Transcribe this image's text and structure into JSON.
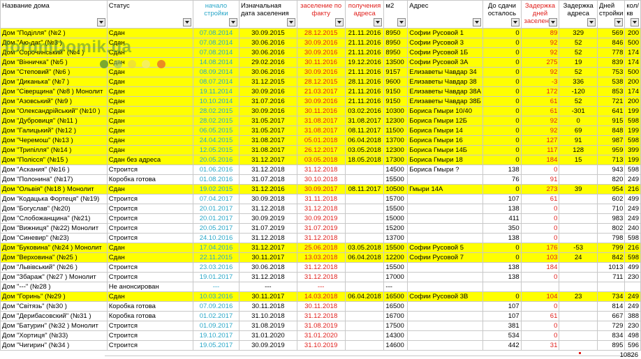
{
  "headers": [
    {
      "label": "Название дома",
      "cls": ""
    },
    {
      "label": "Статус",
      "cls": ""
    },
    {
      "label": "начало стройки",
      "cls": "hcol-blue"
    },
    {
      "label": "Изначальная дата заселения",
      "cls": ""
    },
    {
      "label": "заселение по факту",
      "cls": "hcol-red"
    },
    {
      "label": "получения адреса",
      "cls": "hcol-red"
    },
    {
      "label": "м2",
      "cls": ""
    },
    {
      "label": "Адрес",
      "cls": ""
    },
    {
      "label": "До сдачи осталось",
      "cls": "hcol-center"
    },
    {
      "label": "Задержка дней заселения",
      "cls": "hcol-red"
    },
    {
      "label": "Задержка адреса",
      "cls": "hcol-center"
    },
    {
      "label": "Дней стройки",
      "cls": ""
    },
    {
      "label": "кол/кв",
      "cls": ""
    }
  ],
  "rows": [
    {
      "hl": true,
      "c": [
        "Дом \"Поділля\" (№2 )",
        "Сдан",
        "07.08.2014",
        "30.09.2015",
        "28.12.2015",
        "21.11.2016",
        "8950",
        "Софии Русовой 1",
        "0",
        "89",
        "329",
        "569",
        "200"
      ]
    },
    {
      "hl": true,
      "c": [
        "Дом \"Аю-даг\" (№3 )",
        "Сдан",
        "07.08.2014",
        "30.06.2016",
        "30.09.2016",
        "21.11.2016",
        "8950",
        "Софии Русовой 3",
        "0",
        "92",
        "52",
        "846",
        "500"
      ]
    },
    {
      "hl": true,
      "c": [
        "Дом \"Сорочинський\" (№4 )",
        "Сдан",
        "07.08.2014",
        "30.06.2016",
        "30.09.2016",
        "21.11.2016",
        "8950",
        "Софии Русовой 1Б",
        "0",
        "92",
        "52",
        "778",
        "174"
      ]
    },
    {
      "hl": true,
      "c": [
        "Дом \"Вінничка\" (№5 )",
        "Сдан",
        "14.08.2014",
        "29.02.2016",
        "30.11.2016",
        "19.12.2016",
        "13500",
        "Софии Русовой 3А",
        "0",
        "275",
        "19",
        "839",
        "174"
      ]
    },
    {
      "hl": true,
      "c": [
        "Дом \"Степовий\" (№6 )",
        "Сдан",
        "08.09.2014",
        "30.06.2016",
        "30.09.2016",
        "21.11.2016",
        "9157",
        "Елизаветы Чавдар 34",
        "0",
        "92",
        "52",
        "753",
        "500"
      ]
    },
    {
      "hl": true,
      "c": [
        "Дом \"Диканька\" (№7 )",
        "Сдан",
        "08.07.2014",
        "31.12.2015",
        "28.12.2015",
        "28.11.2016",
        "9600",
        "Елизаветы Чавдар 38",
        "0",
        "-3",
        "336",
        "538",
        "200"
      ]
    },
    {
      "hl": true,
      "c": [
        "Дом \"Сіверщина\" (№8 ) Монолит",
        "Сдан",
        "19.11.2014",
        "30.09.2016",
        "21.03.2017",
        "21.11.2016",
        "9150",
        "Елизаветы Чавдар 38А",
        "0",
        "172",
        "-120",
        "853",
        "174"
      ]
    },
    {
      "hl": true,
      "c": [
        "Дом \"Азовський\" (№9 )",
        "Сдан",
        "10.10.2014",
        "31.07.2016",
        "30.09.2016",
        "21.11.2016",
        "9150",
        "Елизаветы Чавдар 38Б",
        "0",
        "61",
        "52",
        "721",
        "200"
      ]
    },
    {
      "hl": true,
      "c": [
        "Дом \"Олександрійський\" (№10 )",
        "Сдан",
        "28.02.2015",
        "30.09.2016",
        "30.11.2016",
        "03.02.2016",
        "10300",
        "Бориса Гмыри 10/40",
        "0",
        "61",
        "-301",
        "641",
        "199"
      ]
    },
    {
      "hl": true,
      "c": [
        "Дом \"Дубровиця\" (№11 )",
        "Сдан",
        "28.02.2015",
        "31.05.2017",
        "31.08.2017",
        "31.08.2017",
        "12300",
        "Бориса Гмыри 12Б",
        "0",
        "92",
        "0",
        "915",
        "598"
      ]
    },
    {
      "hl": true,
      "c": [
        "Дом \"Галицький\" (№12 )",
        "Сдан",
        "06.05.2015",
        "31.05.2017",
        "31.08.2017",
        "08.11.2017",
        "11500",
        "Бориса Гмыри 14",
        "0",
        "92",
        "69",
        "848",
        "199"
      ]
    },
    {
      "hl": true,
      "c": [
        "Дом \"Черемош\" (№13 )",
        "Сдан",
        "24.04.2015",
        "31.08.2017",
        "05.01.2018",
        "06.04.2018",
        "13700",
        "Бориса Гмыри 16",
        "0",
        "127",
        "91",
        "987",
        "598"
      ]
    },
    {
      "hl": true,
      "c": [
        "Дом \"Трипілля\" (№14 )",
        "Сдан",
        "12.05.2015",
        "31.08.2017",
        "26.12.2017",
        "03.05.2018",
        "12300",
        "Бориса Гмыри 14Б",
        "0",
        "117",
        "128",
        "959",
        "399"
      ]
    },
    {
      "hl": true,
      "c": [
        "Дом \"Полісся\" (№15 )",
        "Сдан без адреса",
        "20.05.2016",
        "31.12.2017",
        "03.05.2018",
        "18.05.2018",
        "17300",
        "Бориса Гмыри 18",
        "0",
        "184",
        "15",
        "713",
        "199"
      ]
    },
    {
      "hl": false,
      "c": [
        "Дом \"Аскания\" (№16 )",
        "Строится",
        "01.06.2016",
        "31.12.2018",
        "31.12.2018",
        "",
        "14500",
        "Бориса Гмыри ?",
        "138",
        "0",
        "",
        "943",
        "598"
      ]
    },
    {
      "hl": false,
      "c": [
        "Дом \"Полонина\" (№17)",
        "Коробка готова",
        "01.08.2016",
        "31.07.2018",
        "30.10.2018",
        "",
        "15500",
        "",
        "76",
        "91",
        "",
        "820",
        "249"
      ]
    },
    {
      "hl": true,
      "c": [
        "Дом \"Ольвія\" (№18 ) Монолит",
        "Сдан",
        "19.02.2015",
        "31.12.2016",
        "30.09.2017",
        "08.11.2017",
        "10500",
        "Гмыри 14А",
        "0",
        "273",
        "39",
        "954",
        "216"
      ]
    },
    {
      "hl": false,
      "c": [
        "Дом \"Кодацька Фортеця\" (№19)",
        "Строится",
        "07.04.2017",
        "30.09.2018",
        "31.11.2018",
        "",
        "15700",
        "",
        "107",
        "61",
        "",
        "602",
        "499"
      ]
    },
    {
      "hl": false,
      "c": [
        "Дом \"Богуслав\" (№20)",
        "Строится",
        "20.01.2017",
        "31.12.2018",
        "31.12.2018",
        "",
        "15500",
        "",
        "138",
        "0",
        "",
        "710",
        "249"
      ]
    },
    {
      "hl": false,
      "c": [
        "Дом \"Слобожанщина\" (№21)",
        "Строится",
        "20.01.2017",
        "30.09.2019",
        "30.09.2019",
        "",
        "15000",
        "",
        "411",
        "0",
        "",
        "983",
        "249"
      ]
    },
    {
      "hl": false,
      "c": [
        "Дом \"Вижниця\" (№22) Монолит",
        "Строится",
        "20.05.2017",
        "31.07.2019",
        "31.07.2019",
        "",
        "15200",
        "",
        "350",
        "0",
        "",
        "802",
        "240"
      ]
    },
    {
      "hl": false,
      "c": [
        "Дом \"Синевир\" (№23)",
        "Строится",
        "24.10.2016",
        "31.12.2018",
        "31.12.2018",
        "",
        "13700",
        "",
        "138",
        "0",
        "",
        "798",
        "598"
      ]
    },
    {
      "hl": true,
      "c": [
        "Дом \"Буковина\" (№24 ) Монолит",
        "Сдан",
        "17.04.2016",
        "31.12.2017",
        "25.06.2018",
        "03.05.2018",
        "15500",
        "Софии Русовой 5",
        "0",
        "176",
        "-53",
        "799",
        "216"
      ]
    },
    {
      "hl": true,
      "c": [
        "Дом \"Верховина\" (№25 )",
        "Сдан",
        "22.11.2015",
        "30.11.2017",
        "13.03.2018",
        "06.04.2018",
        "12200",
        "Софии Русовой 7",
        "0",
        "103",
        "24",
        "842",
        "598"
      ]
    },
    {
      "hl": false,
      "c": [
        "Дом \"Львівський\" (№26 )",
        "Строится",
        "23.03.2016",
        "30.06.2018",
        "31.12.2018",
        "",
        "15500",
        "",
        "138",
        "184",
        "",
        "1013",
        "499"
      ]
    },
    {
      "hl": false,
      "c": [
        "Дом \"Збараж\" (№27 ) Монолит",
        "Строится",
        "19.01.2017",
        "31.12.2018",
        "31.12.2018",
        "",
        "17000",
        "",
        "138",
        "0",
        "",
        "711",
        "230"
      ]
    },
    {
      "hl": false,
      "c": [
        "Дом \"---\" (№28 )",
        "Не анонсирован",
        "---",
        "---",
        "---",
        "",
        "---",
        "",
        "",
        "",
        "",
        "",
        ""
      ]
    },
    {
      "hl": true,
      "c": [
        "Дом \"Горинь\" (№29 )",
        "Сдан",
        "10.03.2016",
        "30.11.2017",
        "14.03.2018",
        "06.04.2018",
        "16500",
        "Софии Русовой 3В",
        "0",
        "104",
        "23",
        "734",
        "249"
      ]
    },
    {
      "hl": false,
      "c": [
        "Дом \"Світязь\" (№30 )",
        "Коробка готова",
        "07.09.2016",
        "30.11.2018",
        "30.11.2018",
        "",
        "16500",
        "",
        "107",
        "0",
        "",
        "814",
        "249"
      ]
    },
    {
      "hl": false,
      "c": [
        "Дом \"Дерибасовский\" (№31 )",
        "Коробка готова",
        "01.02.2017",
        "31.10.2018",
        "31.12.2018",
        "",
        "16700",
        "",
        "107",
        "61",
        "",
        "667",
        "388"
      ]
    },
    {
      "hl": false,
      "c": [
        "Дом \"Батурин\" (№32 ) Монолит",
        "Строится",
        "01.09.2017",
        "31.08.2019",
        "31.08.2019",
        "",
        "17500",
        "",
        "381",
        "0",
        "",
        "729",
        "230"
      ]
    },
    {
      "hl": false,
      "c": [
        "Дом \"Хортиця\" (№33)",
        "Строится",
        "19.10.2017",
        "31.01.2020",
        "31.01.2020",
        "",
        "14300",
        "",
        "534",
        "0",
        "",
        "834",
        "498"
      ]
    },
    {
      "hl": false,
      "c": [
        "Дом \"Чигирин\" (№34 )",
        "Строится",
        "19.05.2017",
        "30.09.2019",
        "31.10.2019",
        "",
        "14600",
        "",
        "442",
        "31",
        "",
        "895",
        "596"
      ]
    }
  ],
  "total": "10826",
  "watermark": "forumDomik.ua",
  "colors": {
    "highlight": "#ffff00",
    "start_blue": "#2aa7c8",
    "delay_red": "#e0201c"
  }
}
